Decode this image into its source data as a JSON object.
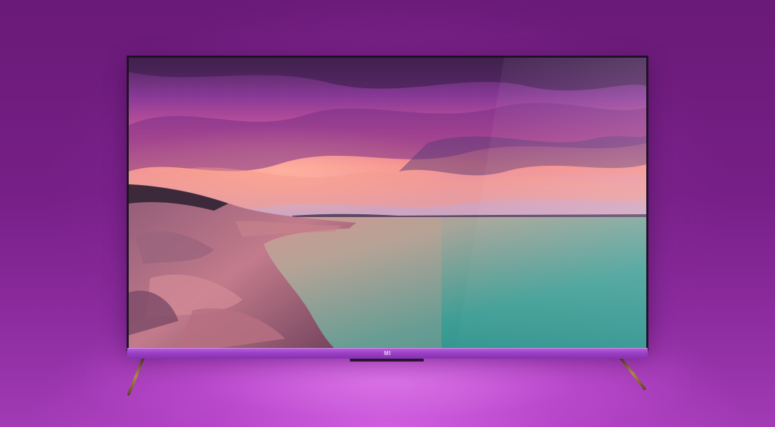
{
  "scene": {
    "subject": "television",
    "brand_logo_text": "MI",
    "screen_content": "seascape-sunset",
    "colors": {
      "backdrop": "#761f86",
      "floor_glow": "#d25fe0",
      "bezel": "#9a3fc3",
      "sky_pink": "#f07a9a",
      "sky_purple": "#8a3a98",
      "water_teal": "#2f9a93",
      "rocks": "#b06f86"
    }
  }
}
